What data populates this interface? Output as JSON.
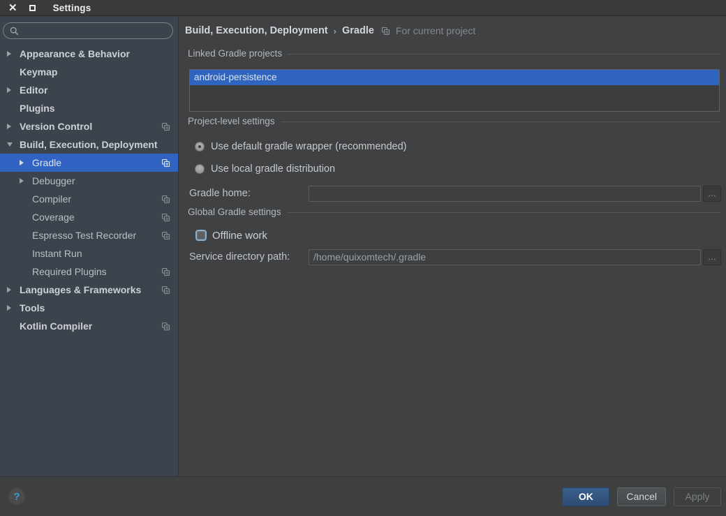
{
  "window": {
    "title": "Settings",
    "close_icon": "✕",
    "maximize_icon": "restore-square"
  },
  "colors": {
    "titlebar_bg": "#3a3a38",
    "sidebar_bg": "#3d434d",
    "panel_bg": "#404142",
    "selection_blue": "#2f64bf",
    "tree_selection_blue": "#3164c2",
    "ok_button_blue": "#33557c",
    "help_icon_blue": "#3b9bd5",
    "checkbox_border_blue": "#85b0d2"
  },
  "sidebar": {
    "search": {
      "placeholder": "",
      "value": "",
      "icon": "search-icon"
    },
    "items": [
      {
        "label": "Appearance & Behavior",
        "level": 0,
        "bold": true,
        "arrow": "right",
        "per_project_icon": false,
        "selected": false
      },
      {
        "label": "Keymap",
        "level": 0,
        "bold": true,
        "arrow": "none",
        "per_project_icon": false,
        "selected": false
      },
      {
        "label": "Editor",
        "level": 0,
        "bold": true,
        "arrow": "right",
        "per_project_icon": false,
        "selected": false
      },
      {
        "label": "Plugins",
        "level": 0,
        "bold": true,
        "arrow": "none",
        "per_project_icon": false,
        "selected": false
      },
      {
        "label": "Version Control",
        "level": 0,
        "bold": true,
        "arrow": "right",
        "per_project_icon": true,
        "selected": false
      },
      {
        "label": "Build, Execution, Deployment",
        "level": 0,
        "bold": true,
        "arrow": "down",
        "per_project_icon": false,
        "selected": false
      },
      {
        "label": "Gradle",
        "level": 1,
        "bold": false,
        "arrow": "right",
        "per_project_icon": true,
        "selected": true
      },
      {
        "label": "Debugger",
        "level": 1,
        "bold": false,
        "arrow": "right",
        "per_project_icon": false,
        "selected": false
      },
      {
        "label": "Compiler",
        "level": 1,
        "bold": false,
        "arrow": "none",
        "per_project_icon": true,
        "selected": false
      },
      {
        "label": "Coverage",
        "level": 1,
        "bold": false,
        "arrow": "none",
        "per_project_icon": true,
        "selected": false
      },
      {
        "label": "Espresso Test Recorder",
        "level": 1,
        "bold": false,
        "arrow": "none",
        "per_project_icon": true,
        "selected": false
      },
      {
        "label": "Instant Run",
        "level": 1,
        "bold": false,
        "arrow": "none",
        "per_project_icon": false,
        "selected": false
      },
      {
        "label": "Required Plugins",
        "level": 1,
        "bold": false,
        "arrow": "none",
        "per_project_icon": true,
        "selected": false
      },
      {
        "label": "Languages & Frameworks",
        "level": 0,
        "bold": true,
        "arrow": "right",
        "per_project_icon": true,
        "selected": false
      },
      {
        "label": "Tools",
        "level": 0,
        "bold": true,
        "arrow": "right",
        "per_project_icon": false,
        "selected": false
      },
      {
        "label": "Kotlin Compiler",
        "level": 0,
        "bold": true,
        "arrow": "none",
        "per_project_icon": true,
        "selected": false
      }
    ]
  },
  "breadcrumb": {
    "path": [
      "Build, Execution, Deployment",
      "Gradle"
    ],
    "separator": "›",
    "scope_icon": "per-project-settings-icon",
    "scope_note": "For current project"
  },
  "sections": {
    "linked": {
      "title": "Linked Gradle projects",
      "projects": [
        "android-persistence"
      ],
      "selected_project": "android-persistence"
    },
    "project_level": {
      "title": "Project-level settings",
      "radio_default_wrapper": {
        "label": "Use default gradle wrapper (recommended)",
        "selected": true
      },
      "radio_local_dist": {
        "label": "Use local gradle distribution",
        "selected": false
      },
      "gradle_home": {
        "label": "Gradle home:",
        "value": "",
        "browse_label": "…"
      }
    },
    "global": {
      "title": "Global Gradle settings",
      "offline_work": {
        "label": "Offline work",
        "checked": false
      },
      "service_dir": {
        "label": "Service directory path:",
        "value": "/home/quixomtech/.gradle",
        "browse_label": "…"
      }
    }
  },
  "footer": {
    "help_label": "?",
    "ok_label": "OK",
    "cancel_label": "Cancel",
    "apply_label": "Apply",
    "apply_enabled": false
  }
}
